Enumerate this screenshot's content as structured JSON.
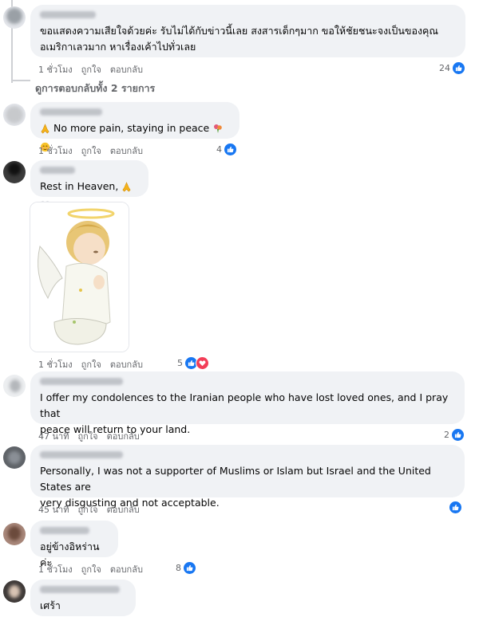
{
  "comments": [
    {
      "text": "ขอแสดงความเสียใจด้วยค่ะ รับไม่ได้กับข่าวนี้เลย สงสารเด็กๆมาก ขอให้ชัยชนะจงเป็นของคุณอเมริกาเลวมาก หาเรื่องเค้าไปทั่วเลย",
      "line1": "ขอแสดงความเสียใจด้วยค่ะ รับไม่ได้กับข่าวนี้เลย สงสารเด็กๆมาก ขอให้ชัยชนะจงเป็นของคุณ",
      "line2": "อเมริกาเลวมาก หาเรื่องเค้าไปทั่วเลย",
      "time": "1 ชั่วโมง",
      "like": "ถูกใจ",
      "reply": "ตอบกลับ",
      "reactions": "24"
    },
    {
      "text": "No more pain, staying in peace",
      "time": "1 ชั่วโมง",
      "like": "ถูกใจ",
      "reply": "ตอบกลับ",
      "reactions": "4"
    },
    {
      "text": "Rest in Heaven,",
      "time": "1 ชั่วโมง",
      "like": "ถูกใจ",
      "reply": "ตอบกลับ",
      "reactions": "5"
    },
    {
      "line1": "I offer my condolences to the Iranian people who have lost loved ones, and I pray that",
      "line2": "peace will return to your land.",
      "time": "47 นาที",
      "like": "ถูกใจ",
      "reply": "ตอบกลับ",
      "reactions": "2"
    },
    {
      "line1": "Personally, I was not a supporter of Muslims or Islam but Israel and the United States are",
      "line2": "very disgusting and not acceptable.",
      "time": "45 นาที",
      "like": "ถูกใจ",
      "reply": "ตอบกลับ"
    },
    {
      "text": "อยู่ข้างอิหร่านค่ะ",
      "time": "1 ชั่วโมง",
      "like": "ถูกใจ",
      "reply": "ตอบกลับ",
      "reactions": "8"
    },
    {
      "text": "เศร้า"
    }
  ],
  "view_replies": "ดูการตอบกลับทั้ง 2 รายการ",
  "colors": {
    "like_blue": "#1877f2",
    "love_red": "#f33e58",
    "bubble": "#f0f2f5",
    "meta": "#65676b"
  },
  "icons": [
    "like-reaction-icon",
    "love-reaction-icon",
    "praying-hands-emoji",
    "bouquet-emoji",
    "relieved-face-emoji",
    "white-heart-emoji",
    "angel-sticker"
  ]
}
